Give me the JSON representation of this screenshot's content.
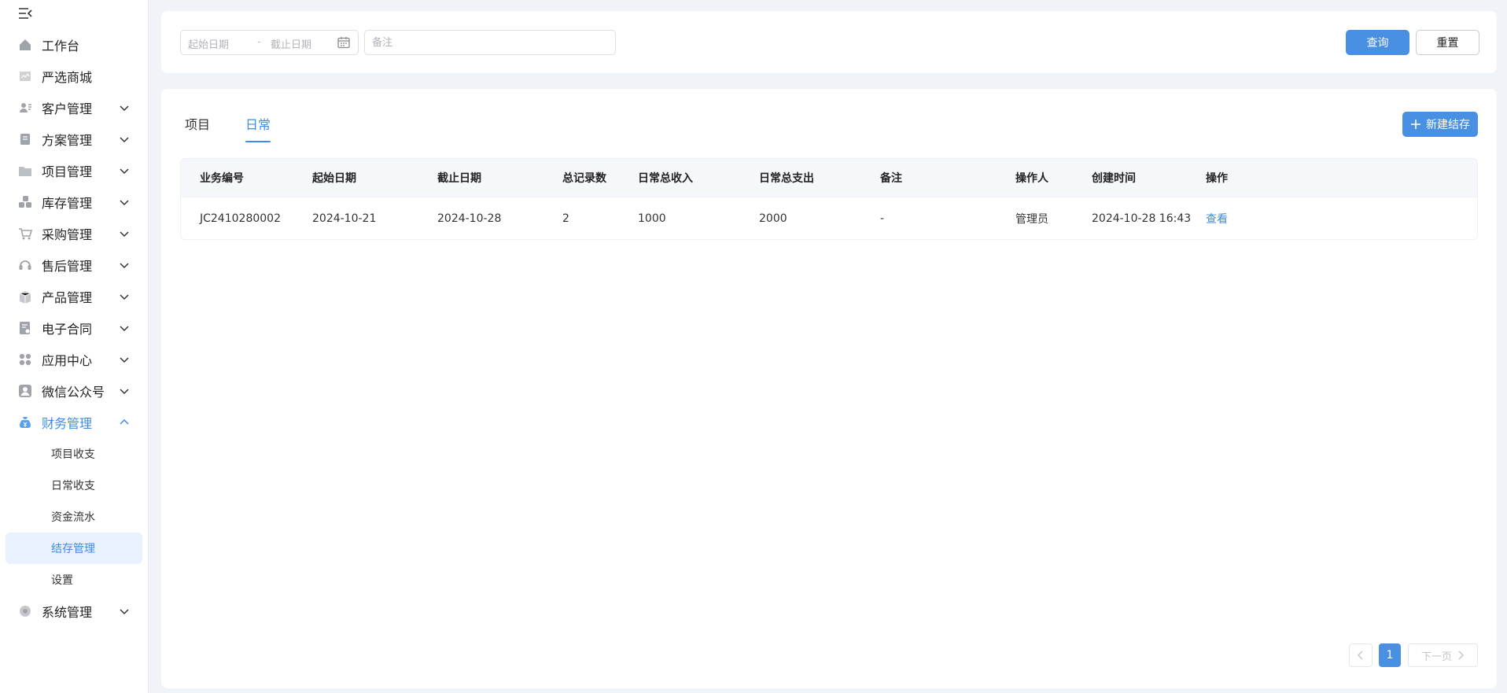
{
  "sidebar": {
    "items": [
      {
        "label": "工作台",
        "icon": "home-icon",
        "has_children": false
      },
      {
        "label": "严选商城",
        "icon": "mall-icon",
        "has_children": false
      },
      {
        "label": "客户管理",
        "icon": "customer-icon",
        "has_children": true
      },
      {
        "label": "方案管理",
        "icon": "plan-icon",
        "has_children": true
      },
      {
        "label": "项目管理",
        "icon": "folder-icon",
        "has_children": true
      },
      {
        "label": "库存管理",
        "icon": "inventory-icon",
        "has_children": true
      },
      {
        "label": "采购管理",
        "icon": "cart-icon",
        "has_children": true
      },
      {
        "label": "售后管理",
        "icon": "headset-icon",
        "has_children": true
      },
      {
        "label": "产品管理",
        "icon": "box-icon",
        "has_children": true
      },
      {
        "label": "电子合同",
        "icon": "contract-icon",
        "has_children": true
      },
      {
        "label": "应用中心",
        "icon": "apps-icon",
        "has_children": true
      },
      {
        "label": "微信公众号",
        "icon": "wechat-icon",
        "has_children": true
      },
      {
        "label": "财务管理",
        "icon": "money-bag-icon",
        "has_children": true,
        "open": true
      },
      {
        "label": "系统管理",
        "icon": "settings-icon",
        "has_children": true
      }
    ],
    "finance_submenu": [
      {
        "label": "项目收支"
      },
      {
        "label": "日常收支"
      },
      {
        "label": "资金流水"
      },
      {
        "label": "结存管理",
        "active": true
      },
      {
        "label": "设置"
      }
    ]
  },
  "filters": {
    "start_date_placeholder": "起始日期",
    "separator": "-",
    "end_date_placeholder": "截止日期",
    "remark_placeholder": "备注",
    "query_label": "查询",
    "reset_label": "重置"
  },
  "tabs": [
    {
      "label": "项目",
      "active": false
    },
    {
      "label": "日常",
      "active": true
    }
  ],
  "new_button_label": "新建结存",
  "table": {
    "headers": [
      "业务编号",
      "起始日期",
      "截止日期",
      "总记录数",
      "日常总收入",
      "日常总支出",
      "备注",
      "操作人",
      "创建时间",
      "操作"
    ],
    "rows": [
      [
        "JC2410280002",
        "2024-10-21",
        "2024-10-28",
        "2",
        "1000",
        "2000",
        "-",
        "管理员",
        "2024-10-28 16:43",
        "查看"
      ]
    ]
  },
  "pagination": {
    "current_page": "1",
    "next_label": "下一页"
  },
  "colors": {
    "accent": "#4a90e2",
    "active_text": "#3d8be6",
    "active_bg": "#e8f1fd"
  }
}
